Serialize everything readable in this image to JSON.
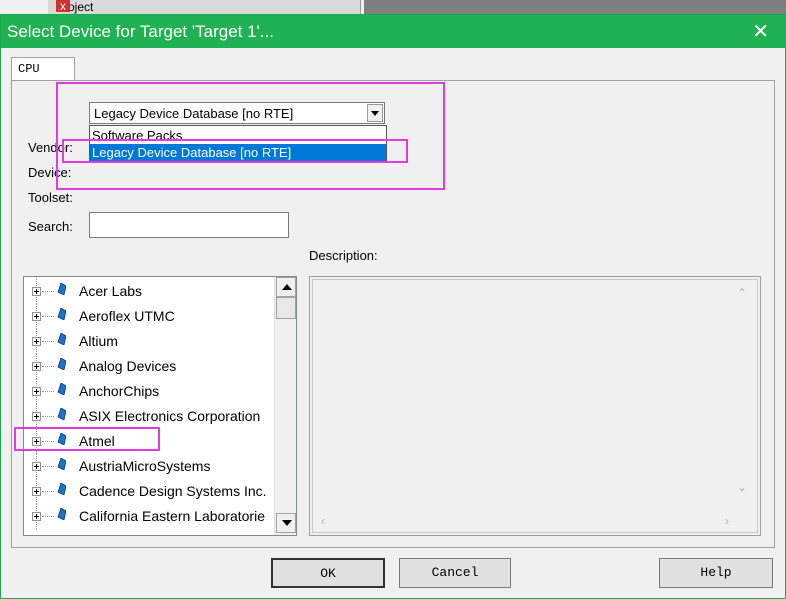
{
  "background": {
    "project_tab_label": "Project",
    "pin_glyph": "❑",
    "close_glyph": "x"
  },
  "dialog": {
    "title": "Select Device for Target 'Target 1'...",
    "close_glyph": "✕",
    "tab_label": "CPU",
    "database_select": {
      "value": "Legacy Device Database [no RTE]",
      "options": [
        "Software Packs",
        "Legacy Device Database [no RTE]"
      ],
      "selected_index": 1
    },
    "labels": {
      "vendor": "Vendor:",
      "device": "Device:",
      "toolset": "Toolset:",
      "search": "Search:",
      "description": "Description:"
    },
    "search_value": "",
    "vendors": [
      "Acer Labs",
      "Aeroflex UTMC",
      "Altium",
      "Analog Devices",
      "AnchorChips",
      "ASIX Electronics Corporation",
      "Atmel",
      "AustriaMicroSystems",
      "Cadence Design Systems Inc.",
      "California Eastern Laboratorie"
    ],
    "buttons": {
      "ok": "OK",
      "cancel": "Cancel",
      "help": "Help"
    }
  },
  "colors": {
    "titlebar": "#1fb152",
    "highlight": "#e23be0",
    "selection": "#0078d7"
  }
}
